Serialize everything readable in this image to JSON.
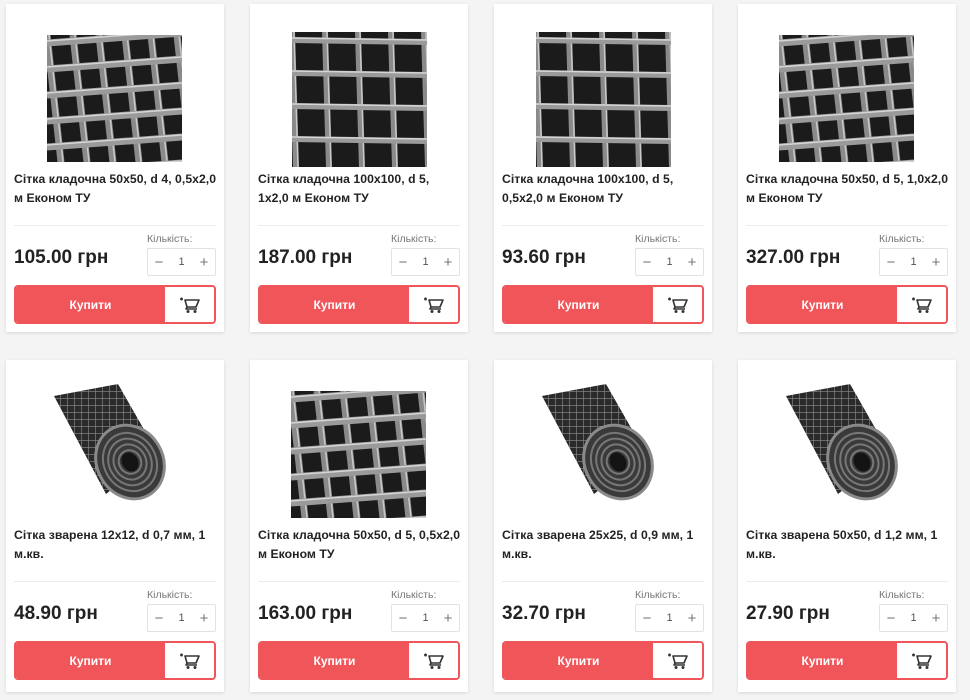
{
  "products": [
    {
      "title": "Сітка кладочна 50x50, d 4, 0,5x2,0 м Економ ТУ",
      "price": "105.00 грн",
      "qty": "1",
      "qty_label": "Кількість:",
      "buy": "Купити",
      "image": "mesh-panel"
    },
    {
      "title": "Сітка кладочна 100x100, d 5, 1x2,0 м Економ ТУ",
      "price": "187.00 грн",
      "qty": "1",
      "qty_label": "Кількість:",
      "buy": "Купити",
      "image": "mesh-panel-large"
    },
    {
      "title": "Сітка кладочна 100x100, d 5, 0,5x2,0 м Економ ТУ",
      "price": "93.60 грн",
      "qty": "1",
      "qty_label": "Кількість:",
      "buy": "Купити",
      "image": "mesh-panel-large"
    },
    {
      "title": "Сітка кладочна 50x50, d 5, 1,0x2,0 м Економ ТУ",
      "price": "327.00 грн",
      "qty": "1",
      "qty_label": "Кількість:",
      "buy": "Купити",
      "image": "mesh-panel"
    },
    {
      "title": "Сітка зварена 12x12, d 0,7 мм, 1 м.кв.",
      "price": "48.90 грн",
      "qty": "1",
      "qty_label": "Кількість:",
      "buy": "Купити",
      "image": "mesh-roll"
    },
    {
      "title": "Сітка кладочна 50x50, d 5, 0,5x2,0 м Економ ТУ",
      "price": "163.00 грн",
      "qty": "1",
      "qty_label": "Кількість:",
      "buy": "Купити",
      "image": "mesh-panel"
    },
    {
      "title": "Сітка зварена 25x25, d 0,9 мм, 1 м.кв.",
      "price": "32.70 грн",
      "qty": "1",
      "qty_label": "Кількість:",
      "buy": "Купити",
      "image": "mesh-roll"
    },
    {
      "title": "Сітка зварена 50x50, d 1,2 мм, 1 м.кв.",
      "price": "27.90 грн",
      "qty": "1",
      "qty_label": "Кількість:",
      "buy": "Купити",
      "image": "mesh-roll"
    }
  ],
  "icons": {
    "minus": "minus-icon",
    "plus": "plus-icon",
    "cart": "cart-add-icon"
  },
  "colors": {
    "accent": "#f0555a",
    "price_text": "#222222"
  }
}
